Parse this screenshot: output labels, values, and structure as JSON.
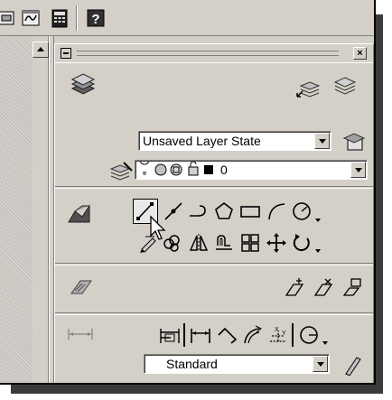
{
  "layers_panel": {
    "layer_state": "Unsaved Layer State",
    "current_layer": "0",
    "current_layer_color": "#000000"
  },
  "dimensions_panel": {
    "dim_style": "Standard"
  },
  "icons": {
    "toolbar": [
      "toolbar-icon-1",
      "toolbar-icon-2",
      "calculator-icon",
      "help-icon"
    ],
    "draw_row1": [
      "line-icon",
      "construction-line-icon",
      "polyline-icon",
      "polygon-icon",
      "rectangle-icon",
      "arc-icon",
      "circle-icon"
    ],
    "draw_row2": [
      "pencil-icon",
      "copy-icon",
      "mirror-icon",
      "offset-icon",
      "array-icon",
      "move-icon",
      "rotate-icon"
    ]
  }
}
